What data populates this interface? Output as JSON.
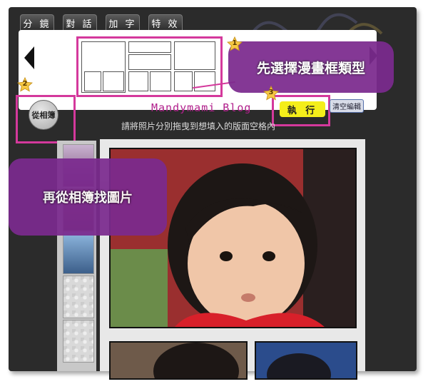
{
  "tabs": [
    "分 鏡",
    "對 話",
    "加 字",
    "特 效"
  ],
  "callouts": {
    "step1": "先選擇漫畫框類型",
    "step2": "再從相簿找圖片"
  },
  "steps": [
    "1",
    "2",
    "3"
  ],
  "blog_text": "Mandymami Blog",
  "execute_label": "執 行",
  "clear_label": "清空編輯",
  "album_label": "從相簿",
  "hint_text": "請將照片分別拖曳到想填入的版面空格內",
  "colors": {
    "highlight": "#d4399c",
    "callout": "#7b2a8e",
    "execute": "#f4ee1a",
    "blog": "#b1208c"
  }
}
